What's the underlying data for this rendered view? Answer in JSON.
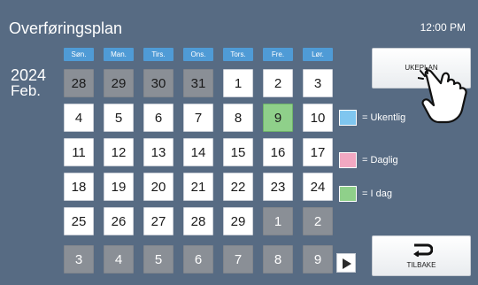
{
  "header": {
    "title": "Overføringsplan",
    "time": "12:00 PM"
  },
  "calendar": {
    "year": "2024",
    "month": "Feb.",
    "weekdays": [
      "Søn.",
      "Man.",
      "Tirs.",
      "Ons.",
      "Tors.",
      "Fre.",
      "Lør."
    ],
    "weeks": [
      [
        "28",
        "29",
        "30",
        "31",
        "1",
        "2",
        "3"
      ],
      [
        "4",
        "5",
        "6",
        "7",
        "8",
        "9",
        "10"
      ],
      [
        "11",
        "12",
        "13",
        "14",
        "15",
        "16",
        "17"
      ],
      [
        "18",
        "19",
        "20",
        "21",
        "22",
        "23",
        "24"
      ],
      [
        "25",
        "26",
        "27",
        "28",
        "29",
        "1",
        "2"
      ],
      [
        "3",
        "4",
        "5",
        "6",
        "7",
        "8",
        "9"
      ]
    ],
    "today": "9"
  },
  "legend": {
    "weekly": {
      "label": "= Ukentlig",
      "color": "#7fc6ef"
    },
    "daily": {
      "label": "= Daglig",
      "color": "#f2a8c2"
    },
    "today": {
      "label": "= I dag",
      "color": "#8fd08a"
    }
  },
  "buttons": {
    "weekly_plan": "UKEPLAN",
    "back": "TILBAKE"
  },
  "icons": {
    "next": "play-triangle-icon",
    "back": "return-arrow-icon",
    "pointer": "pointing-hand-icon"
  }
}
